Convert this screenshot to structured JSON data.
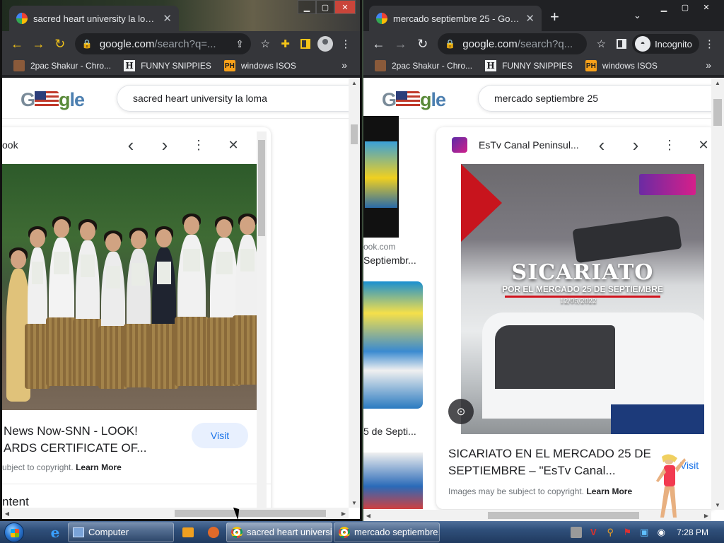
{
  "left_window": {
    "tab_title": "sacred heart university la loma - ",
    "url_host": "google.com",
    "url_path": "/search?q=...",
    "bookmarks": [
      "2pac Shakur - Chro...",
      "FUNNY SNIPPIES",
      "windows ISOS"
    ],
    "search_query": "sacred heart university la loma",
    "panel": {
      "source": "ook",
      "title_line1": "News Now-SNN - LOOK!",
      "title_line2": "ARDS CERTIFICATE OF...",
      "visit": "Visit",
      "copyright": "ubject to copyright.",
      "learn_more": "Learn More",
      "below": "ntent"
    }
  },
  "right_window": {
    "tab_title": "mercado septiembre 25 - Google",
    "url_host": "google.com",
    "url_path": "/search?q...",
    "incognito": "Incognito",
    "bookmarks": [
      "2pac Shakur - Chro...",
      "FUNNY SNIPPIES",
      "windows ISOS"
    ],
    "search_query": "mercado septiembre 25",
    "side_results": {
      "source": "ook.com",
      "caption": "Septiembr...",
      "caption2": "5 de Septi..."
    },
    "panel": {
      "source": "EsTv Canal Peninsul...",
      "image_headline": "SICARIATO",
      "image_sub": "POR EL MERCADO 25 DE SEPTIEMBRE",
      "image_date": "12/05/2022",
      "title_line1": "SICARIATO EN EL MERCADO 25 DE",
      "title_line2": "SEPTIEMBRE – \"EsTv Canal...",
      "visit": "Visit",
      "copyright": "Images may be subject to copyright.",
      "learn_more": "Learn More"
    }
  },
  "taskbar": {
    "items": [
      "Computer",
      "sacred heart universi...",
      "mercado septiembre..."
    ],
    "clock": "7:28 PM"
  },
  "icons": {
    "back": "←",
    "forward": "→",
    "reload": "↻",
    "lock": "🔒",
    "share": "⇪",
    "star": "☆",
    "puzzle": "✚",
    "menu": "⋮",
    "prev": "‹",
    "next": "›",
    "close": "✕",
    "lens": "⊙"
  },
  "colors": {
    "chrome_dark": "#202124",
    "chrome_toolbar": "#35363a",
    "google_blue": "#1a73e8",
    "visit_bg": "#e8f0fe"
  }
}
